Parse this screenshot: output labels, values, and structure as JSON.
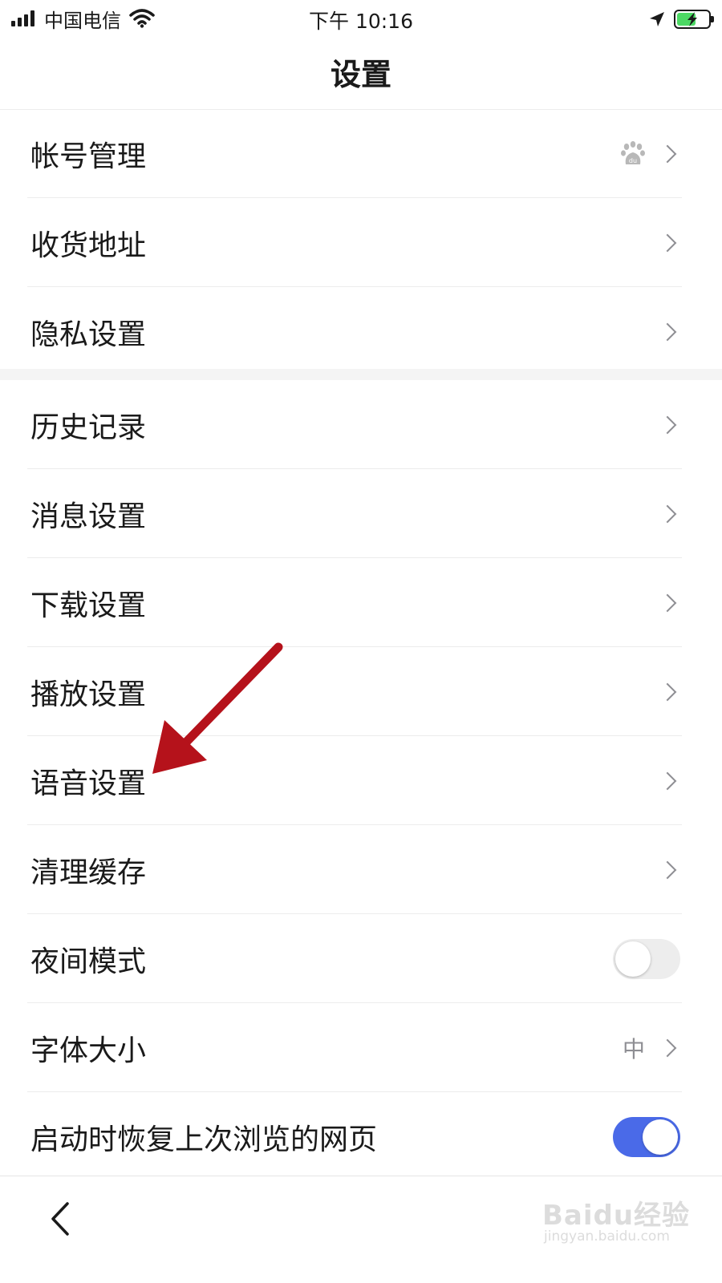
{
  "status_bar": {
    "carrier": "中国电信",
    "time": "下午 10:16",
    "battery_level_percent": 60,
    "battery_color": "#4cd964"
  },
  "nav": {
    "title": "设置"
  },
  "group1": [
    {
      "label": "帐号管理",
      "trailing_icon": "baidu-paw-icon"
    },
    {
      "label": "收货地址"
    },
    {
      "label": "隐私设置"
    }
  ],
  "group2": [
    {
      "label": "历史记录"
    },
    {
      "label": "消息设置"
    },
    {
      "label": "下载设置"
    },
    {
      "label": "播放设置"
    },
    {
      "label": "语音设置"
    },
    {
      "label": "清理缓存"
    },
    {
      "label": "夜间模式",
      "toggle_on": false
    },
    {
      "label": "字体大小",
      "value": "中"
    },
    {
      "label": "启动时恢复上次浏览的网页",
      "toggle_on": true
    }
  ],
  "tab_bar": {
    "back_icon": "chevron-left-icon"
  },
  "annotation": {
    "arrow_color": "#b5121b",
    "points_to": "语音设置"
  },
  "watermark": {
    "brand": "Baidu经验",
    "url": "jingyan.baidu.com"
  },
  "colors": {
    "accent": "#4a6ae8",
    "chevron": "#8e8e93",
    "divider": "#ececec"
  }
}
